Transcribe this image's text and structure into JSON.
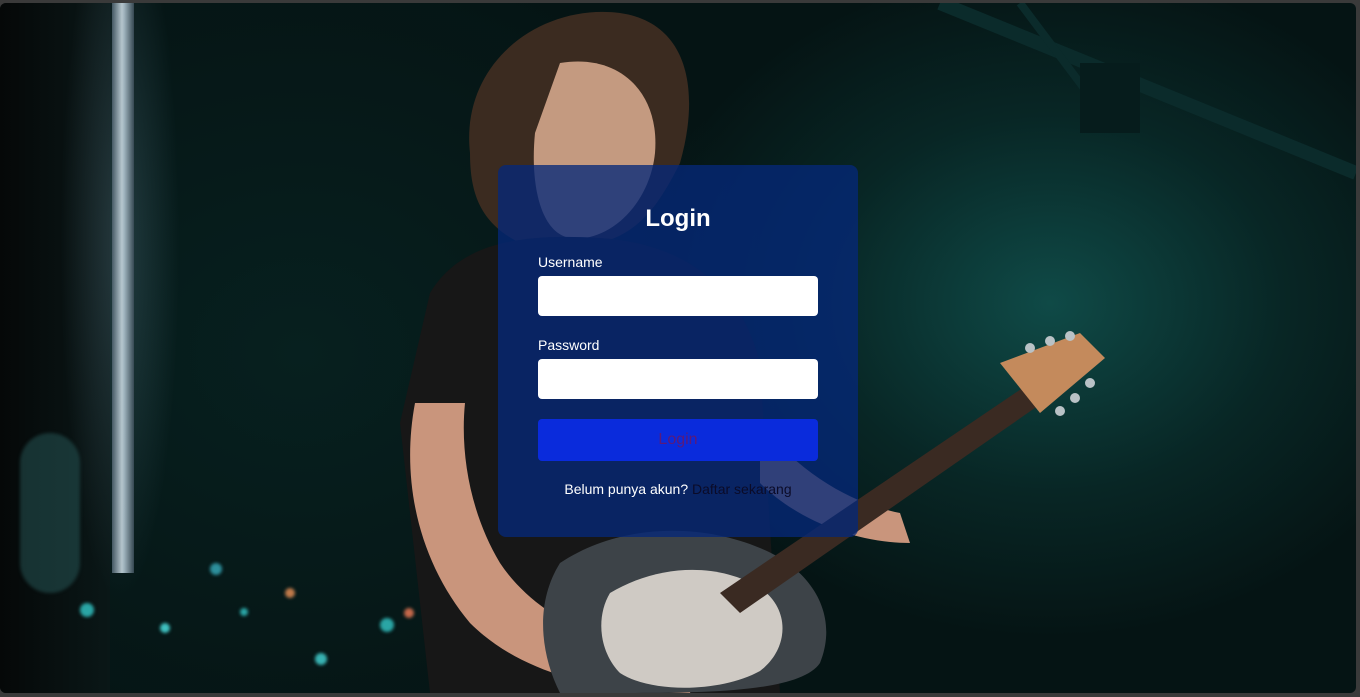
{
  "login": {
    "title": "Login",
    "username_label": "Username",
    "username_value": "",
    "password_label": "Password",
    "password_value": "",
    "button_label": "Login",
    "register_prompt": "Belum punya akun?",
    "register_link": "Daftar sekarang"
  },
  "colors": {
    "card_bg": "#05287a",
    "button_bg": "#0a2bdc",
    "link": "#0b0b28"
  },
  "icons": {
    "background": "concert-guitarist-photo"
  }
}
